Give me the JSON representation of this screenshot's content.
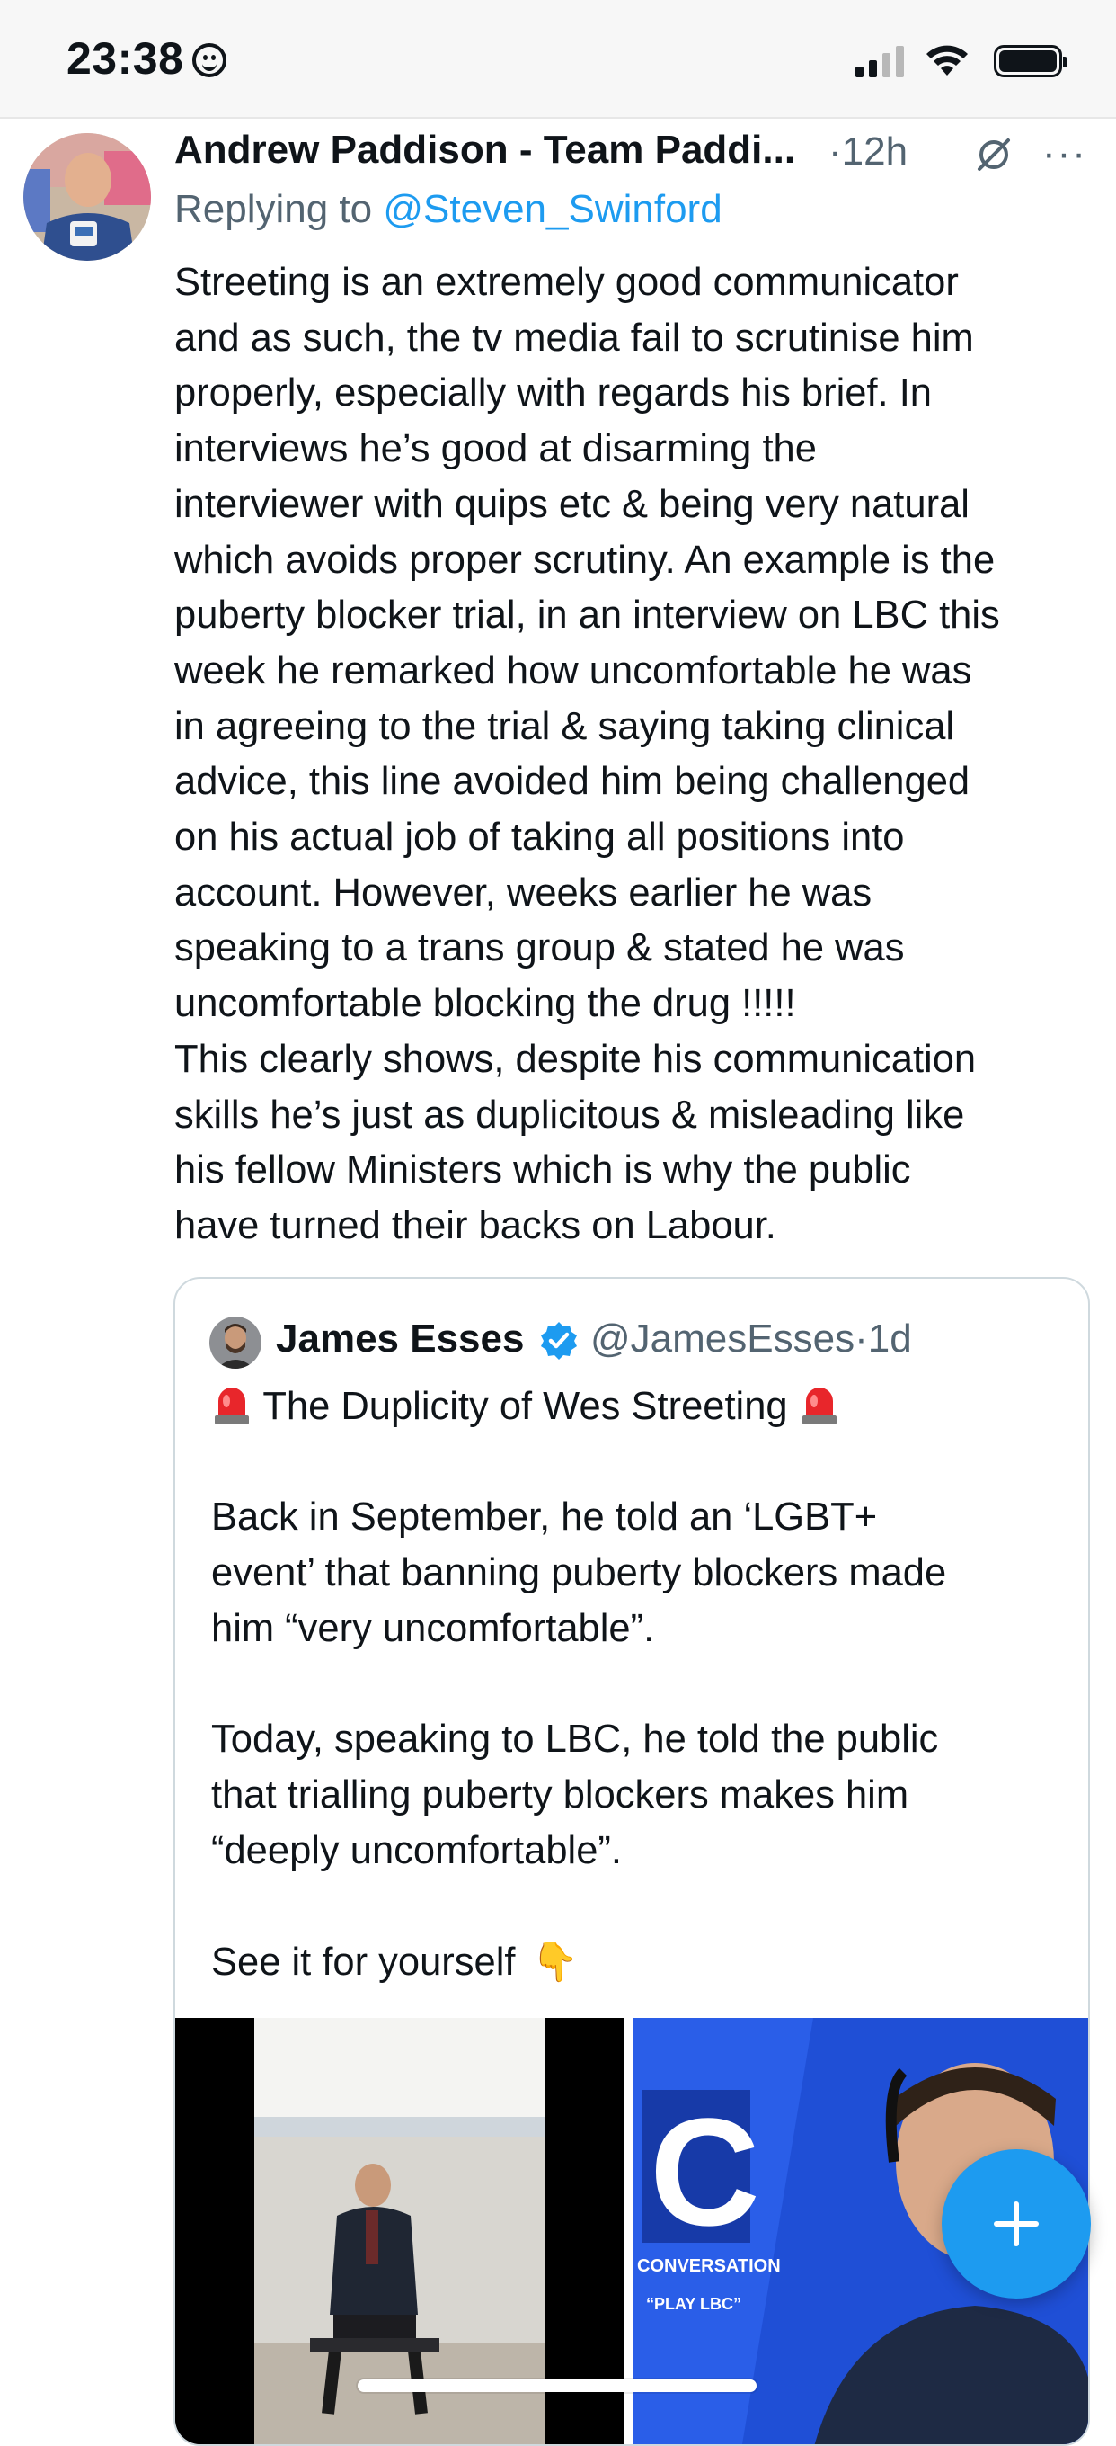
{
  "status_bar": {
    "time": "23:38",
    "time_emoji": "smiley-face-icon"
  },
  "tweet": {
    "author_name": "Andrew Paddison - Team Paddi...",
    "separator": "·",
    "timestamp": "12h",
    "replying_prefix": "Replying to",
    "replying_handle": "@Steven_Swinford",
    "more_label": "···",
    "text_lines": [
      "Streeting is an extremely good communicator",
      "and as such, the tv media fail to scrutinise him",
      "properly, especially with regards his brief. In",
      "interviews he’s good at disarming the",
      "interviewer with quips etc & being very natural",
      "which avoids proper scrutiny. An example is the",
      "puberty blocker trial, in an interview on LBC this",
      "week he remarked how uncomfortable he was",
      "in agreeing to the trial & saying taking clinical",
      "advice, this line avoided him being challenged",
      "on his actual job of taking all positions into",
      "account. However, weeks earlier he was",
      "speaking to a trans group & stated he was",
      "uncomfortable blocking the drug !!!!!",
      "This clearly shows, despite his communication",
      "skills he’s just as duplicitous & misleading like",
      "his fellow Ministers which is why the public",
      "have turned their backs on Labour."
    ]
  },
  "quoted_tweet": {
    "author_name": "James Esses",
    "handle": "@JamesEsses",
    "separator": "·",
    "timestamp": "1d",
    "title": "The Duplicity of Wes Streeting",
    "lines": [
      "",
      "Back in September, he told an ‘LGBT+",
      "event’ that banning puberty blockers made",
      "him “very uncomfortable”.",
      "",
      "Today, speaking to LBC, he told the public",
      "that trialling puberty blockers makes him",
      "“deeply uncomfortable”.",
      "",
      "See it for yourself"
    ],
    "pointing_emoji": "👇",
    "media_right_text": {
      "logo": "C",
      "line1": "CONVERSATION",
      "line2": "“PLAY LBC”"
    }
  },
  "fab": {
    "label": "+"
  },
  "colors": {
    "accent": "#1d9bf0",
    "secondary_text": "#536471",
    "border": "#cfd9de"
  }
}
